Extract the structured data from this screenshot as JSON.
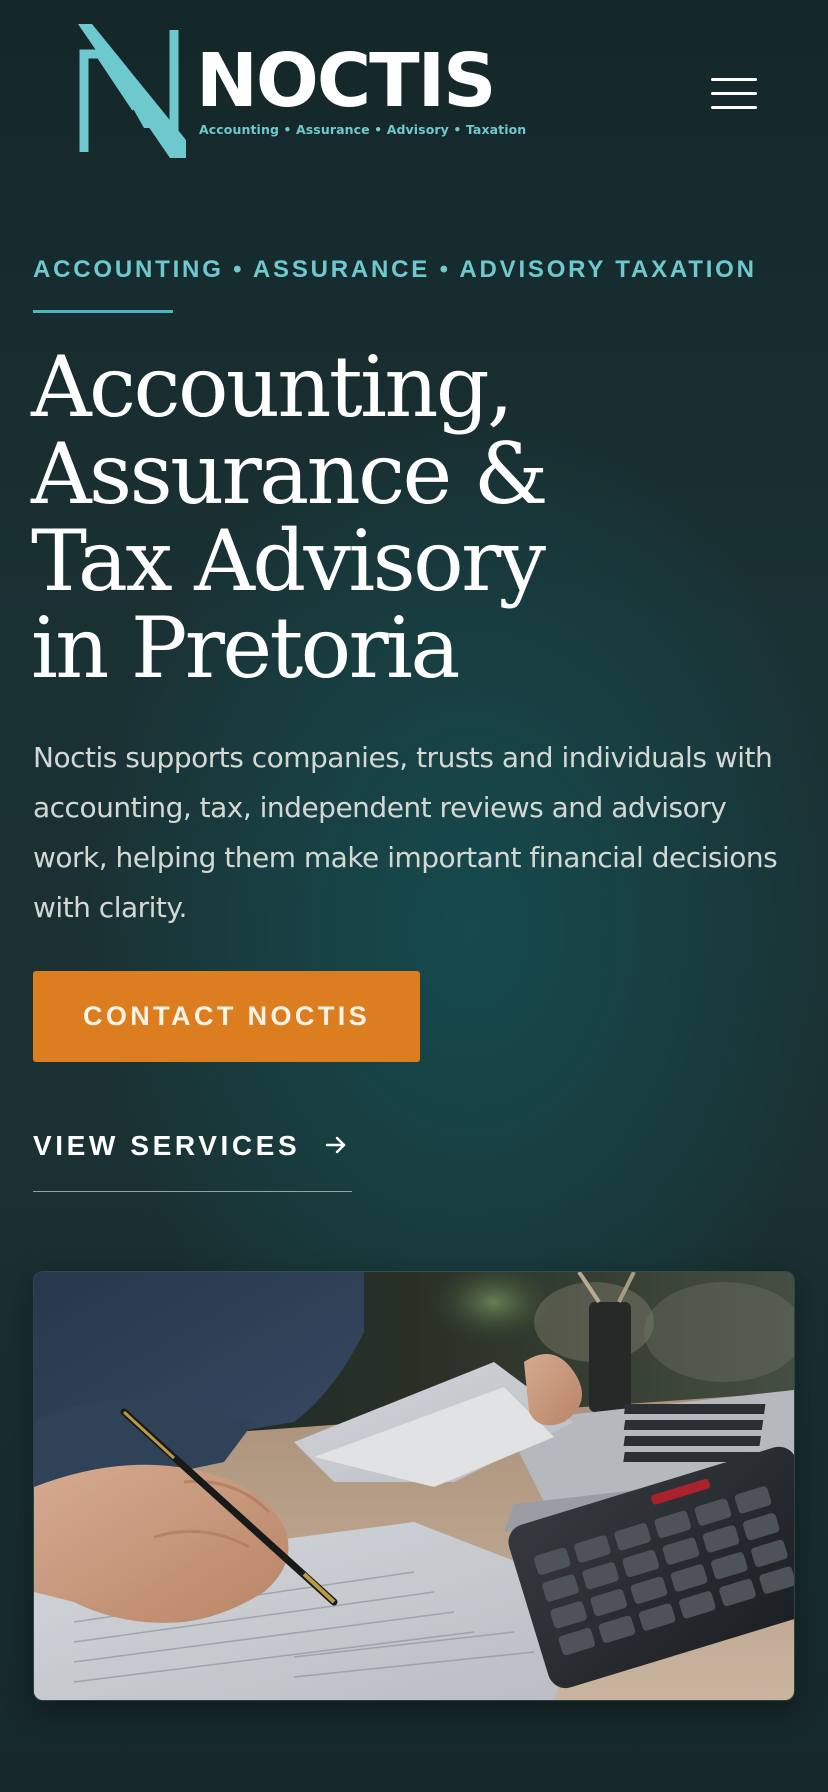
{
  "header": {
    "brand_name": "NOCTIS",
    "brand_tagline": "Accounting • Assurance • Advisory • Taxation",
    "logo_icon": "noctis-n-monogram",
    "menu_icon": "hamburger-menu-icon"
  },
  "hero": {
    "eyebrow": "ACCOUNTING • ASSURANCE • ADVISORY TAXATION",
    "headline_lines": [
      "Accounting,",
      "Assurance &",
      "Tax Advisory",
      "in Pretoria"
    ],
    "intro": "Noctis supports companies, trusts and individuals with accounting, tax, independent reviews and advisory work, helping them make important financial decisions with clarity.",
    "primary_cta": "CONTACT NOCTIS",
    "secondary_cta": "VIEW SERVICES",
    "secondary_cta_icon": "arrow-right-icon",
    "image_subject": "person-writing-on-paperwork-with-calculator-and-laptop"
  },
  "colors": {
    "background": "#1a3134",
    "accent_teal": "#6ec9cf",
    "cta_orange": "#dc7d1f",
    "body_text": "#d4d8d4",
    "heading": "#ffffff"
  }
}
